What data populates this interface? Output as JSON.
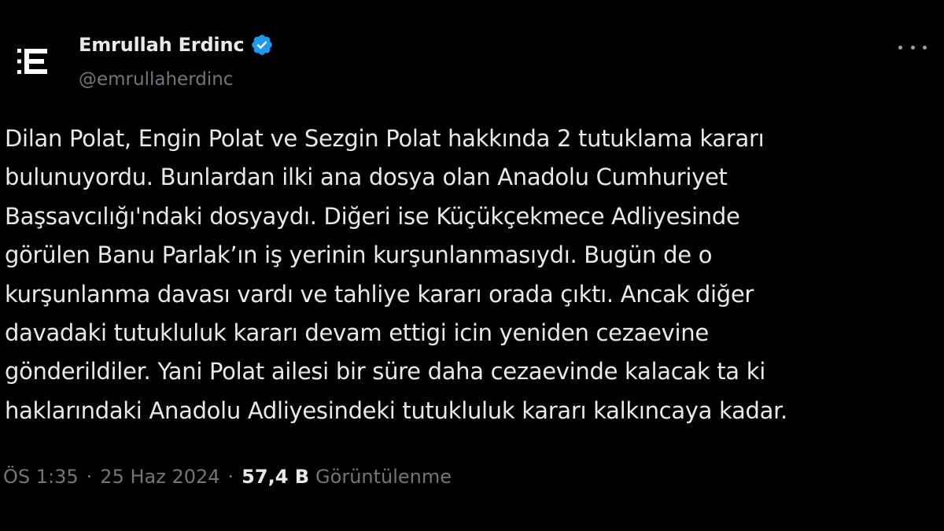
{
  "author": {
    "display_name": "Emrullah Erdinc",
    "handle": "@emrullaherdinc",
    "avatar_icon": "e-logo-icon",
    "verified_icon": "verified-badge-icon"
  },
  "tweet": {
    "text": "Dilan Polat, Engin Polat ve Sezgin Polat hakkında 2 tutuklama kararı\nbulunuyordu. Bunlardan ilki ana dosya olan Anadolu Cumhuriyet\nBaşsavcılığı'ndaki dosyaydı. Diğeri ise Küçükçekmece Adliyesinde\ngörülen Banu Parlak’ın iş yerinin kurşunlanmasıydı. Bugün de o\nkurşunlanma davası vardı ve tahliye kararı orada çıktı. Ancak diğer\ndavadaki tutukluluk kararı devam ettigi icin yeniden cezaevine\ngönderildiler. Yani Polat ailesi bir süre daha cezaevinde kalacak ta ki\nhaklarındaki Anadolu Adliyesindeki tutukluluk kararı kalkıncaya kadar.",
    "time": "ÖS 1:35",
    "separator": "·",
    "date": "25 Haz 2024",
    "views_count": "57,4 B",
    "views_label": "Görüntülenme"
  },
  "colors": {
    "background": "#000000",
    "primary_text": "#e7e9ea",
    "secondary_text": "#71767b",
    "verified_blue": "#1d9bf0"
  },
  "icons": {
    "more": "more-horizontal-icon"
  }
}
